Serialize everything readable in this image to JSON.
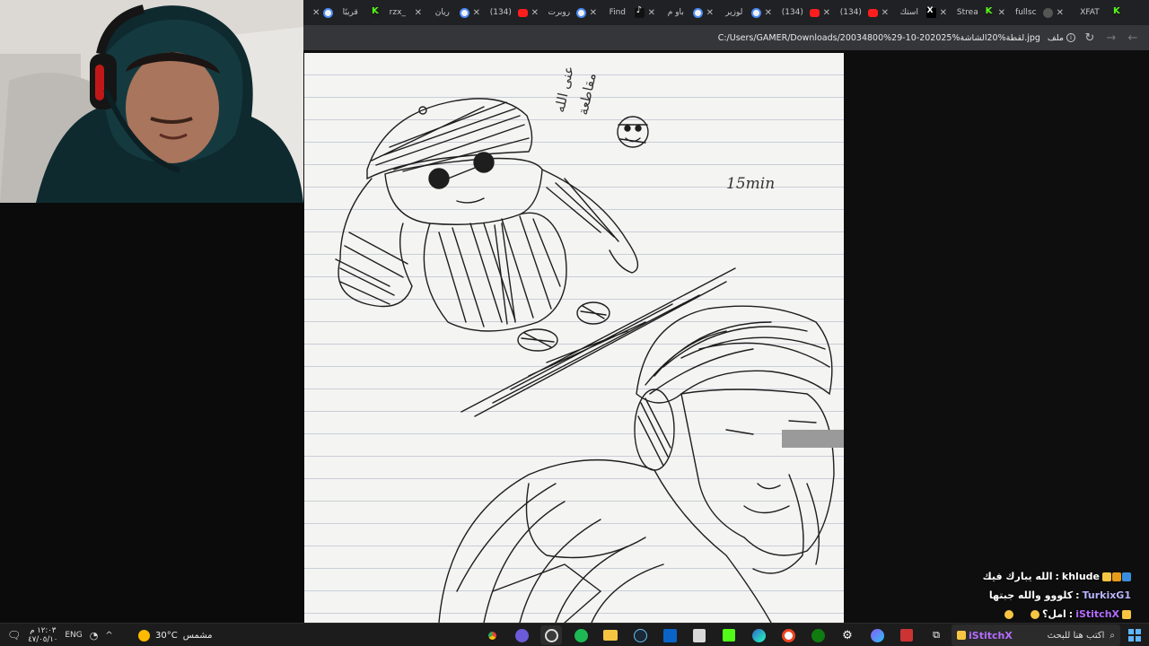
{
  "tabs": [
    {
      "label": "قريبًا",
      "icon": "chrome-icon"
    },
    {
      "label": "rzx_",
      "icon": "kick-icon"
    },
    {
      "label": "ريان",
      "icon": "chrome-icon"
    },
    {
      "label": "(134)",
      "icon": "youtube-icon"
    },
    {
      "label": "روبرت",
      "icon": "chrome-icon"
    },
    {
      "label": "Find",
      "icon": "tiktok-icon"
    },
    {
      "label": "باو م",
      "icon": "chrome-icon"
    },
    {
      "label": "لوزير",
      "icon": "chrome-icon"
    },
    {
      "label": "(134)",
      "icon": "youtube-icon"
    },
    {
      "label": "(134)",
      "icon": "youtube-icon"
    },
    {
      "label": "استك",
      "icon": "x-icon"
    },
    {
      "label": "Strea",
      "icon": "kick-icon"
    },
    {
      "label": "fullsc",
      "icon": "globe-icon"
    },
    {
      "label": "XFAT",
      "icon": "kick-icon"
    }
  ],
  "address": {
    "file_label": "ملف",
    "path": "C:/Users/GAMER/Downloads/20034800%29-10-202025%لقطة%20الشاشة.jpg"
  },
  "drawing": {
    "note_time": "15min",
    "note_arabic": "عنى الله مقاطعة"
  },
  "chat": [
    {
      "user": "khlude",
      "message": "الله يبارك فيك",
      "color": "#ffffff"
    },
    {
      "user": "TurkixG1",
      "message": "كلووو والله جبتها",
      "color": "#b9b4ff"
    },
    {
      "user": "iStitchX",
      "message": "امل؟",
      "color": "#b46cff"
    }
  ],
  "taskbar": {
    "time": "١٢:٠٣ م",
    "date": "٤٧/٠٥/١٠",
    "lang": "ENG",
    "temperature": "30°C",
    "weather": "مشمس",
    "search_placeholder": "اكتب هنا للبحث",
    "overlay_user": "iStitchX"
  }
}
